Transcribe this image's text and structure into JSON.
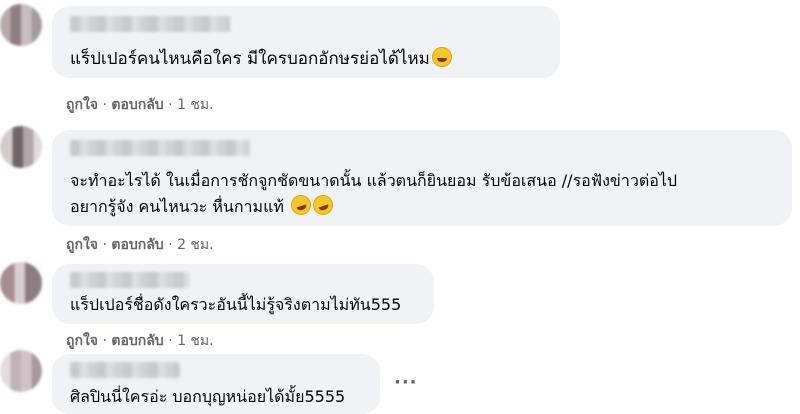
{
  "comments": [
    {
      "text": "แร็ปเปอร์คนไหนคือใคร มีใครบอกอักษรย่อได้ไหม",
      "emoji": [
        "grinning-sweat-face"
      ],
      "like": "ถูกใจ",
      "reply": "ตอบกลับ",
      "time": "1 ชม."
    },
    {
      "line1": "จะทำอะไรได้ ในเมื่อการชักจูกชัดขนาดนั้น แล้วตนก็ยินยอม รับข้อเสนอ //รอฟังข่าวต่อไป",
      "line2": "อยากรู้จัง คนไหนวะ หื่นกามแท้",
      "emoji": [
        "rolling-laughing-face",
        "rolling-laughing-face"
      ],
      "like": "ถูกใจ",
      "reply": "ตอบกลับ",
      "time": "2 ชม."
    },
    {
      "text": "แร็ปเปอร์ชื่อดังใครวะอันนี้ไม่รู้จริงตามไม่ทัน555",
      "like": "ถูกใจ",
      "reply": "ตอบกลับ",
      "time": "1 ชม."
    },
    {
      "text": "ศิลปินนี่ใครอ่ะ บอกบุญหน่อยได้มั้ย5555"
    }
  ],
  "separator": "·",
  "more_icon_glyph": "···"
}
